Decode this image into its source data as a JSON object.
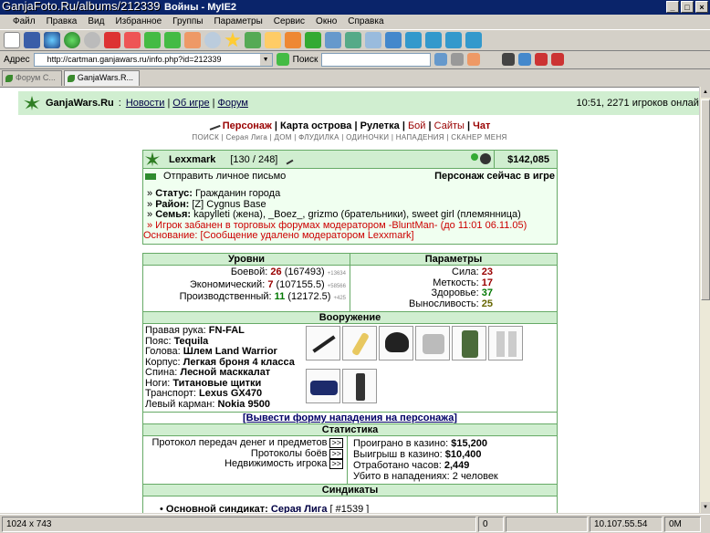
{
  "watermark": "GanjaFoto.Ru/albums/212339",
  "window": {
    "title": "Войны - MyIE2"
  },
  "menu": [
    "Файл",
    "Правка",
    "Вид",
    "Избранное",
    "Группы",
    "Параметры",
    "Сервис",
    "Окно",
    "Справка"
  ],
  "address": {
    "label": "Адрес",
    "url": "http://cartman.ganjawars.ru/info.php?id=212339",
    "search_label": "Поиск"
  },
  "tabs": [
    {
      "label": "Форум С..."
    },
    {
      "label": "GanjaWars.R..."
    }
  ],
  "site": {
    "brand": "GanjaWars.Ru",
    "sep": ":",
    "nav_links": [
      "Новости",
      "Об игре",
      "Форум"
    ],
    "online": "10:51, 2271 игроков онлайн",
    "main_nav": [
      "Персонаж",
      "Карта острова",
      "Рулетка",
      "Бой",
      "Сайты",
      "Чат"
    ],
    "sub_nav": "ПОИСК | Серая Лига | ДОМ | ФЛУДИЛКА | ОДИНОЧКИ | НАПАДЕНИЯ | СКАНЕР МЕНЯ"
  },
  "profile": {
    "nick": "Lexxmark",
    "level": "[130 / 248]",
    "money": "$142,085",
    "send_mail": "Отправить личное письмо",
    "in_game": "Персонаж сейчас в игре",
    "status_label": "Статус:",
    "status": "Гражданин города",
    "district_label": "Район:",
    "district": "[Z] Cygnus Base",
    "family_label": "Семья:",
    "family": "kapylleti (жена), _Boez_, grizmo (брательники), sweet girl (племянница)",
    "ban": "» Игрок забанен в торговых форумах модератором -BluntMan- (до 11:01 06.11.05)",
    "reason": "Основание: [Сообщение удалено модератором Lexxmark]"
  },
  "levels": {
    "title": "Уровни",
    "rows": [
      {
        "label": "Боевой:",
        "value": "26",
        "exp": "(167493)",
        "extra": "+13634"
      },
      {
        "label": "Экономический:",
        "value": "7",
        "exp": "(107155.5)",
        "extra": "+58566"
      },
      {
        "label": "Производственный:",
        "value": "11",
        "exp": "(12172.5)",
        "extra": "+425"
      }
    ]
  },
  "params": {
    "title": "Параметры",
    "rows": [
      {
        "label": "Сила:",
        "value": "23"
      },
      {
        "label": "Меткость:",
        "value": "17"
      },
      {
        "label": "Здоровье:",
        "value": "37"
      },
      {
        "label": "Выносливость:",
        "value": "25"
      }
    ]
  },
  "weapons": {
    "title": "Вооружение",
    "rows": [
      {
        "label": "Правая рука:",
        "value": "FN-FAL"
      },
      {
        "label": "Пояс:",
        "value": "Tequila"
      },
      {
        "label": "Голова:",
        "value": "Шлем Land Warrior"
      },
      {
        "label": "Корпус:",
        "value": "Легкая броня 4 класса"
      },
      {
        "label": "Спина:",
        "value": "Лесной масккалат"
      },
      {
        "label": "Ноги:",
        "value": "Титановые щитки"
      },
      {
        "label": "Транспорт:",
        "value": "Lexus GX470"
      },
      {
        "label": "Левый карман:",
        "value": "Nokia 9500"
      }
    ],
    "items": [
      "rifle-icon",
      "bottle-icon",
      "helmet-icon",
      "armor-icon",
      "camo-icon",
      "shin-guards-icon",
      "car-icon",
      "phone-icon"
    ]
  },
  "attack_link": "[Вывести форму нападения на персонажа]",
  "statistics": {
    "title": "Статистика",
    "left": [
      {
        "label": "Протокол передач денег и предметов",
        "btn": ">>"
      },
      {
        "label": "Протоколы боёв",
        "btn": ">>"
      },
      {
        "label": "Недвижимость игрока",
        "btn": ">>"
      }
    ],
    "right": [
      {
        "label": "Проиграно в казино:",
        "value": "$15,200"
      },
      {
        "label": "Выигрыш в казино:",
        "value": "$10,400"
      },
      {
        "label": "Отработано часов:",
        "value": "2,449"
      },
      {
        "label": "Убито в нападениях:",
        "value": "2 человек"
      }
    ]
  },
  "syndicates": {
    "title": "Синдикаты",
    "main_label": "Основной синдикат:",
    "main_name": "Серая Лига",
    "main_id": "[ #1539 ]"
  },
  "statusbar": {
    "resolution": "1024 x 743",
    "count": "0",
    "ip": "10.107.55.54",
    "speed": "0M"
  }
}
